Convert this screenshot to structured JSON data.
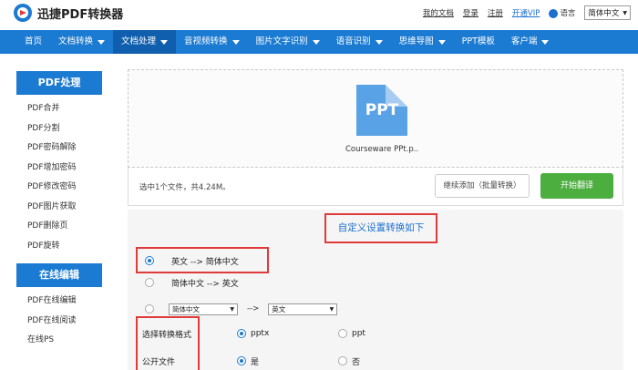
{
  "header": {
    "brand": "迅捷PDF转换器",
    "links": [
      "我的文档",
      "登录",
      "注册"
    ],
    "vip": "开通VIP",
    "lang_label": "语言",
    "lang_value": "简体中文"
  },
  "nav": {
    "items": [
      {
        "label": "首页",
        "dropdown": false,
        "active": false
      },
      {
        "label": "文档转换",
        "dropdown": true,
        "active": false
      },
      {
        "label": "文档处理",
        "dropdown": true,
        "active": true
      },
      {
        "label": "音视频转换",
        "dropdown": true,
        "active": false
      },
      {
        "label": "图片文字识别",
        "dropdown": true,
        "active": false
      },
      {
        "label": "语音识别",
        "dropdown": true,
        "active": false
      },
      {
        "label": "思维导图",
        "dropdown": true,
        "active": false
      },
      {
        "label": "PPT模板",
        "dropdown": false,
        "active": false
      },
      {
        "label": "客户端",
        "dropdown": true,
        "active": false
      }
    ]
  },
  "sidebar": {
    "section1": {
      "title": "PDF处理",
      "items": [
        "PDF合并",
        "PDF分割",
        "PDF密码解除",
        "PDF增加密码",
        "PDF修改密码",
        "PDF图片获取",
        "PDF删除页",
        "PDF旋转"
      ]
    },
    "section2": {
      "title": "在线编辑",
      "items": [
        "PDF在线编辑",
        "PDF在线阅读",
        "在线PS"
      ]
    }
  },
  "upload": {
    "icon_text": "PPT",
    "file_name": "Courseware PPt.p...",
    "info": "选中1个文件，共4.24M。",
    "add_button": "继续添加（批量转换）",
    "start_button": "开始翻译"
  },
  "settings": {
    "title": "自定义设置转换如下",
    "option1": "英文 --> 简体中文",
    "option2": "简体中文 --> 英文",
    "custom_from": "简体中文",
    "custom_arrow": "-->",
    "custom_to": "英文",
    "format_label": "选择转换格式",
    "format_opt1": "pptx",
    "format_opt2": "ppt",
    "public_label": "公开文件",
    "public_yes": "是",
    "public_no": "否"
  },
  "colors": {
    "brand_blue": "#1b7ad1",
    "start_green": "#4cae3e",
    "highlight_red": "#e03a3a"
  }
}
